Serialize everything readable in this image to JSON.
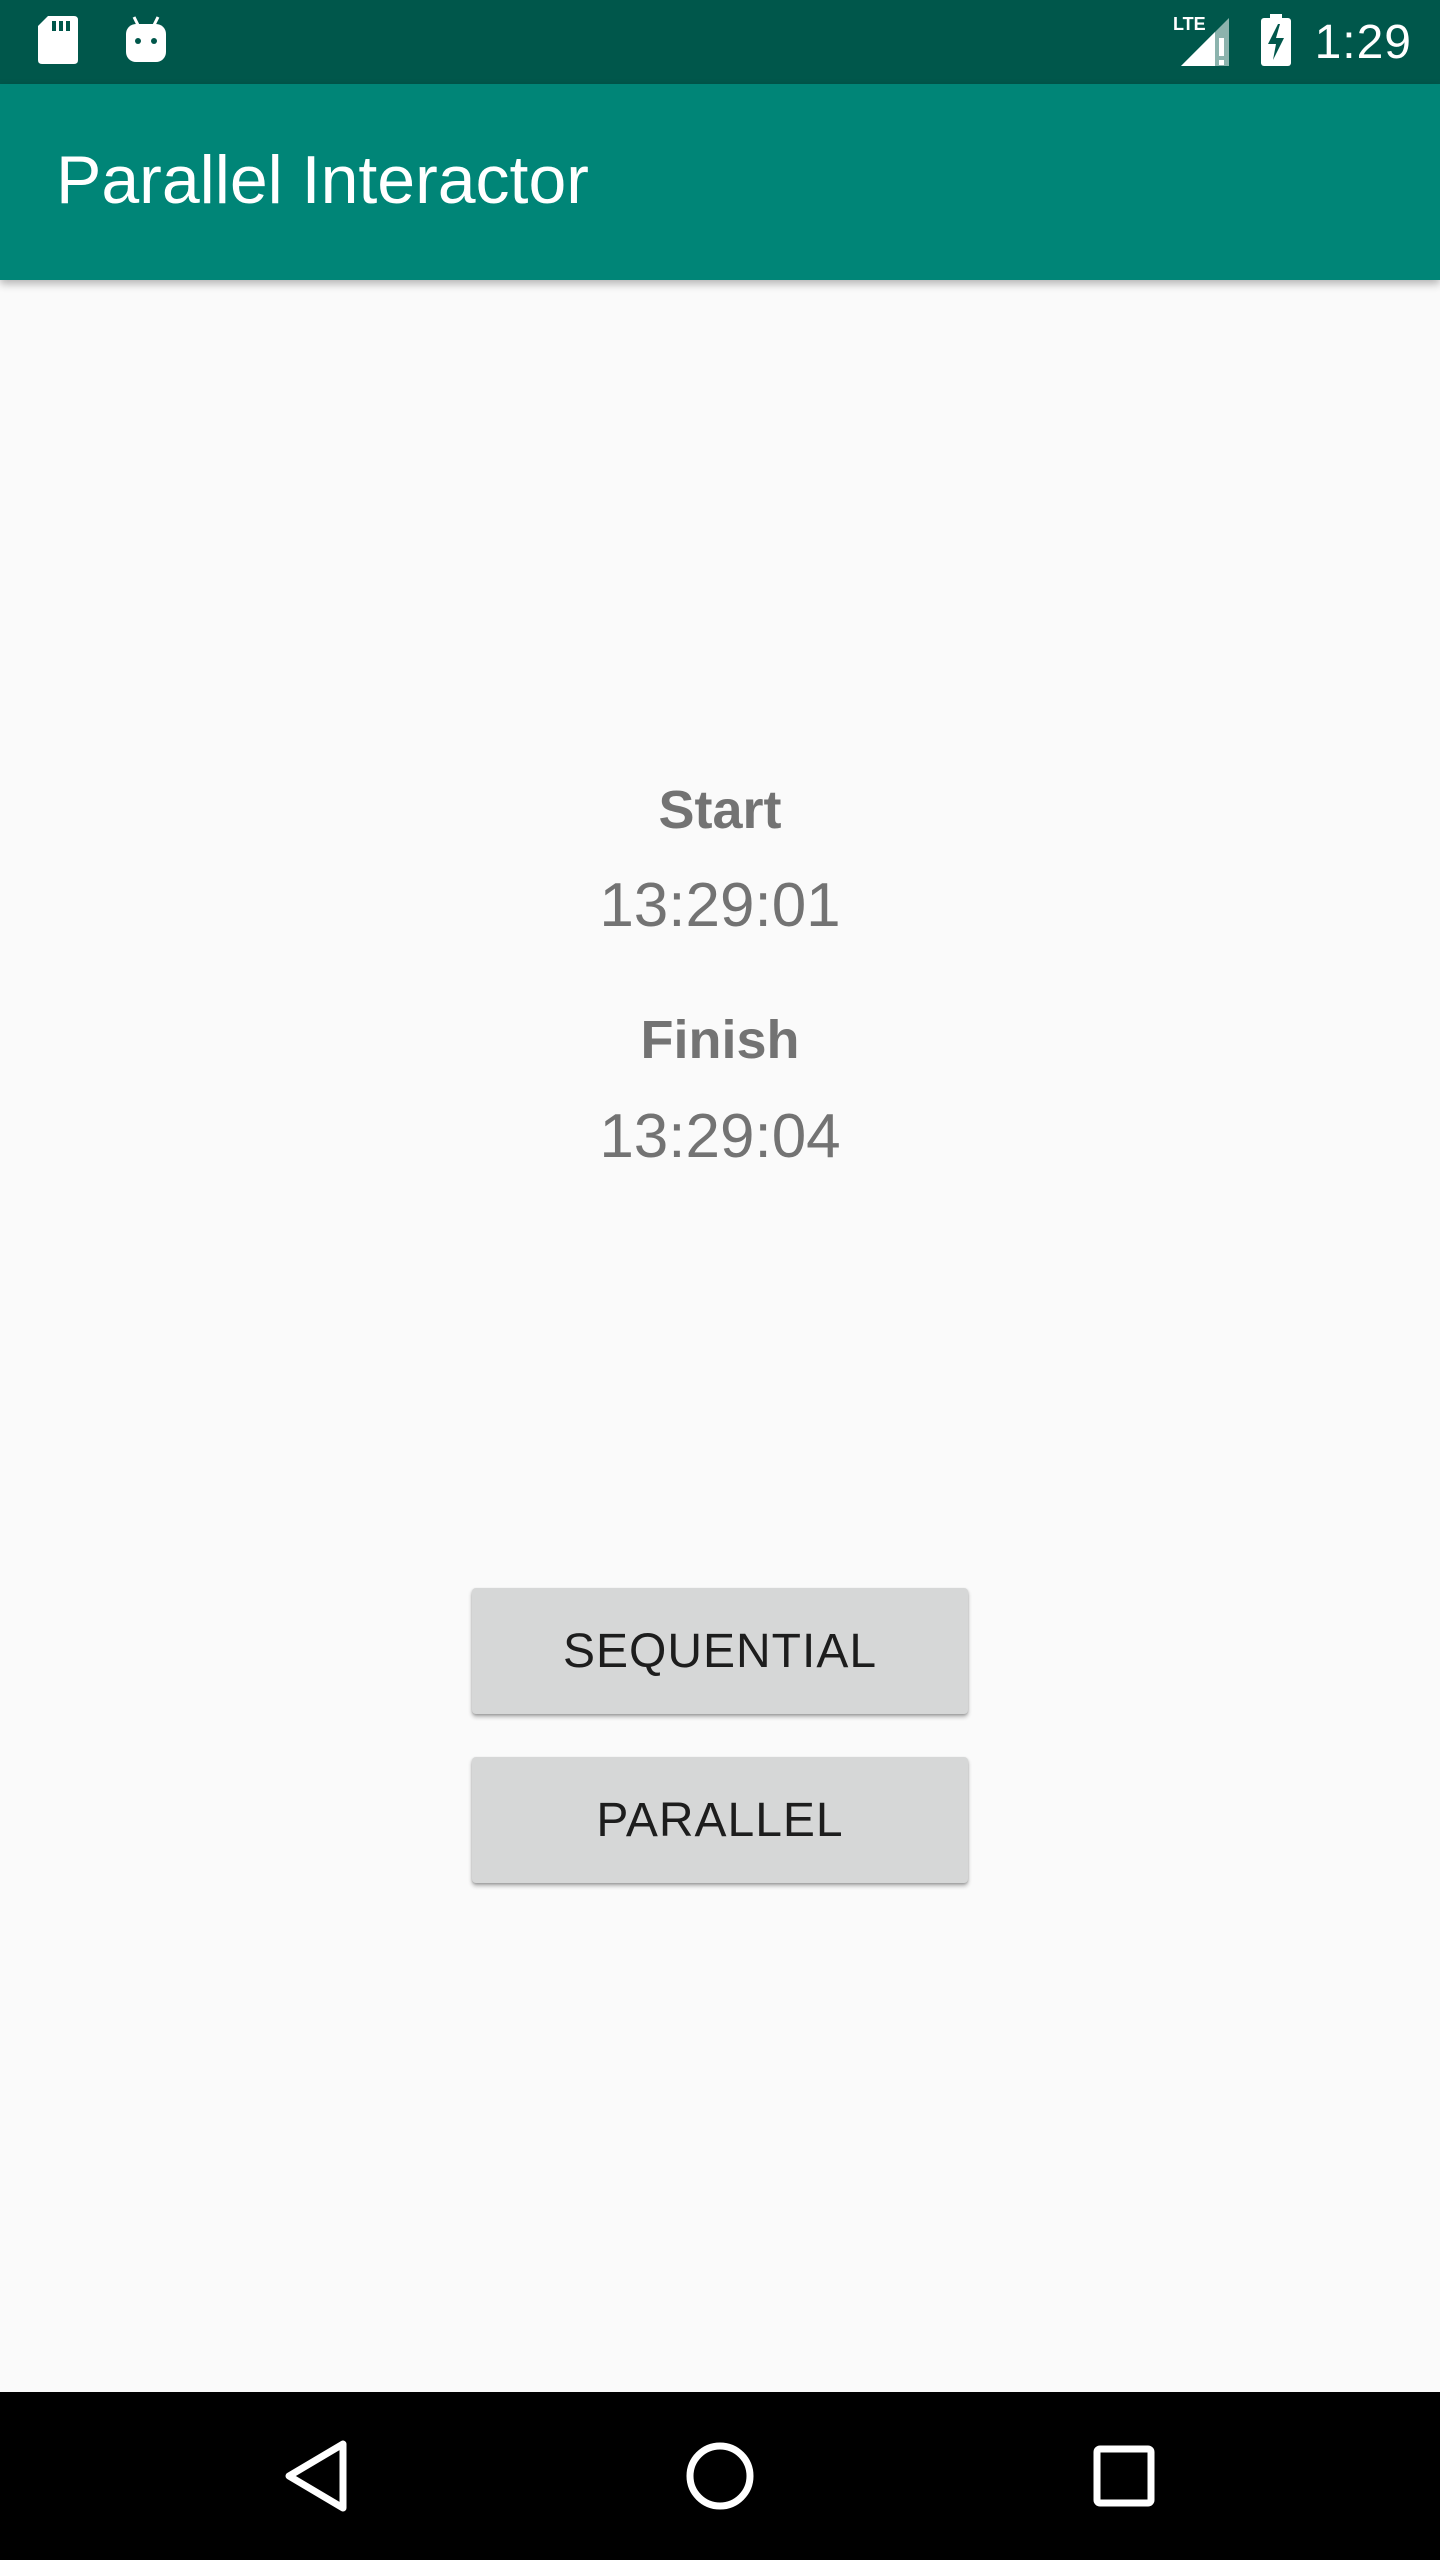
{
  "status_bar": {
    "time": "1:29",
    "network_label": "LTE",
    "icons": [
      "sd-card-icon",
      "android-icon",
      "lte-signal-icon",
      "battery-charging-icon"
    ]
  },
  "app_bar": {
    "title": "Parallel Interactor"
  },
  "main": {
    "start_label": "Start",
    "start_time": "13:29:01",
    "finish_label": "Finish",
    "finish_time": "13:29:04",
    "buttons": [
      {
        "label": "SEQUENTIAL"
      },
      {
        "label": "PARALLEL"
      }
    ]
  },
  "navigation": {
    "icons": [
      "back-icon",
      "home-icon",
      "recents-icon"
    ]
  },
  "colors": {
    "status_bar": "#00574b",
    "app_bar": "#008577",
    "background": "#fafafa",
    "button": "#d6d7d7",
    "text_gray": "#737373"
  }
}
